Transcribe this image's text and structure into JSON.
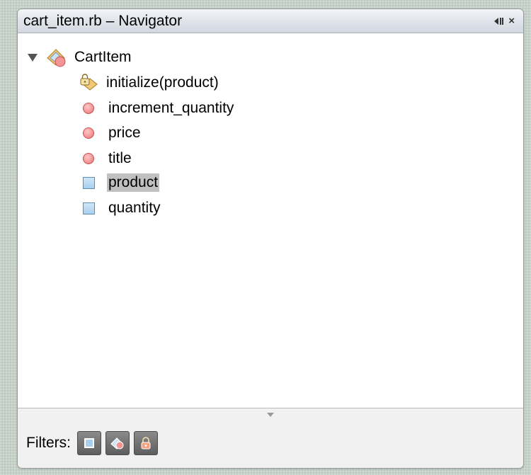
{
  "window": {
    "title": "cart_item.rb – Navigator",
    "minimize_icon": "minimize-icon",
    "close_label": "×"
  },
  "tree": {
    "root": {
      "label": "CartItem",
      "icon": "class-icon",
      "expanded": true,
      "children": [
        {
          "label": "initialize(product)",
          "icon": "constructor-icon"
        },
        {
          "label": "increment_quantity",
          "icon": "method-icon"
        },
        {
          "label": "price",
          "icon": "method-icon"
        },
        {
          "label": "title",
          "icon": "method-icon"
        },
        {
          "label": "product",
          "icon": "field-icon",
          "selected": true
        },
        {
          "label": "quantity",
          "icon": "field-icon"
        }
      ]
    }
  },
  "footer": {
    "filters_label": "Filters:",
    "filter_buttons": [
      {
        "icon": "show-fields-icon"
      },
      {
        "icon": "show-inherited-icon"
      },
      {
        "icon": "show-private-icon"
      }
    ]
  },
  "colors": {
    "method": "#f49494",
    "field": "#a8d0ee",
    "selection": "#c0c0c0",
    "filter_button": "#6e6e6e"
  }
}
